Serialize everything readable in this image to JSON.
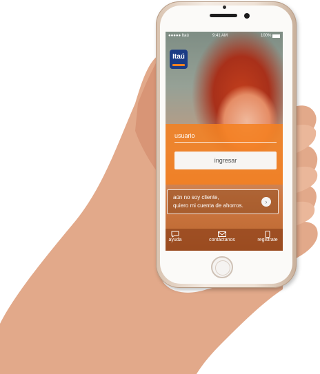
{
  "status_bar": {
    "carrier": "●●●●● Itaú",
    "time": "9:41 AM",
    "battery": "100%"
  },
  "brand": {
    "logo_text": "Itaú"
  },
  "login": {
    "username_placeholder": "usuario",
    "submit_label": "ingresar"
  },
  "promo": {
    "line1": "aún no soy cliente,",
    "line2": "quiero mi cuenta de ahorros."
  },
  "tabbar": [
    {
      "label": "ayuda",
      "icon": "chat-bubble-icon"
    },
    {
      "label": "contáctanos",
      "icon": "envelope-icon"
    },
    {
      "label": "registrate",
      "icon": "phone-icon"
    }
  ],
  "colors": {
    "accent": "#f58220",
    "brand_blue": "#1b3c85"
  }
}
